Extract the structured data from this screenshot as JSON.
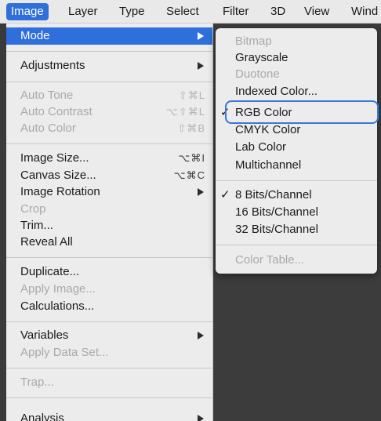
{
  "menubar": {
    "items": [
      "Image",
      "Layer",
      "Type",
      "Select",
      "Filter",
      "3D",
      "View",
      "Wind"
    ]
  },
  "image_menu": {
    "mode": "Mode",
    "adjustments": "Adjustments",
    "auto_tone": {
      "label": "Auto Tone",
      "shortcut": "⇧⌘L"
    },
    "auto_contrast": {
      "label": "Auto Contrast",
      "shortcut": "⌥⇧⌘L"
    },
    "auto_color": {
      "label": "Auto Color",
      "shortcut": "⇧⌘B"
    },
    "image_size": {
      "label": "Image Size...",
      "shortcut": "⌥⌘I"
    },
    "canvas_size": {
      "label": "Canvas Size...",
      "shortcut": "⌥⌘C"
    },
    "image_rotation": "Image Rotation",
    "crop": "Crop",
    "trim": "Trim...",
    "reveal_all": "Reveal All",
    "duplicate": "Duplicate...",
    "apply_image": "Apply Image...",
    "calculations": "Calculations...",
    "variables": "Variables",
    "apply_data_set": "Apply Data Set...",
    "trap": "Trap...",
    "analysis": "Analysis"
  },
  "mode_submenu": {
    "bitmap": "Bitmap",
    "grayscale": "Grayscale",
    "duotone": "Duotone",
    "indexed_color": "Indexed Color...",
    "rgb_color": "RGB Color",
    "cmyk_color": "CMYK Color",
    "lab_color": "Lab Color",
    "multichannel": "Multichannel",
    "bits8": "8 Bits/Channel",
    "bits16": "16 Bits/Channel",
    "bits32": "32 Bits/Channel",
    "color_table": "Color Table...",
    "checkmark": "✓"
  },
  "colors": {
    "accent": "#2f6fdc",
    "menu_bg": "#ececec",
    "disabled_text": "#a9a9a9",
    "canvas_bg": "#3c3c3c"
  }
}
